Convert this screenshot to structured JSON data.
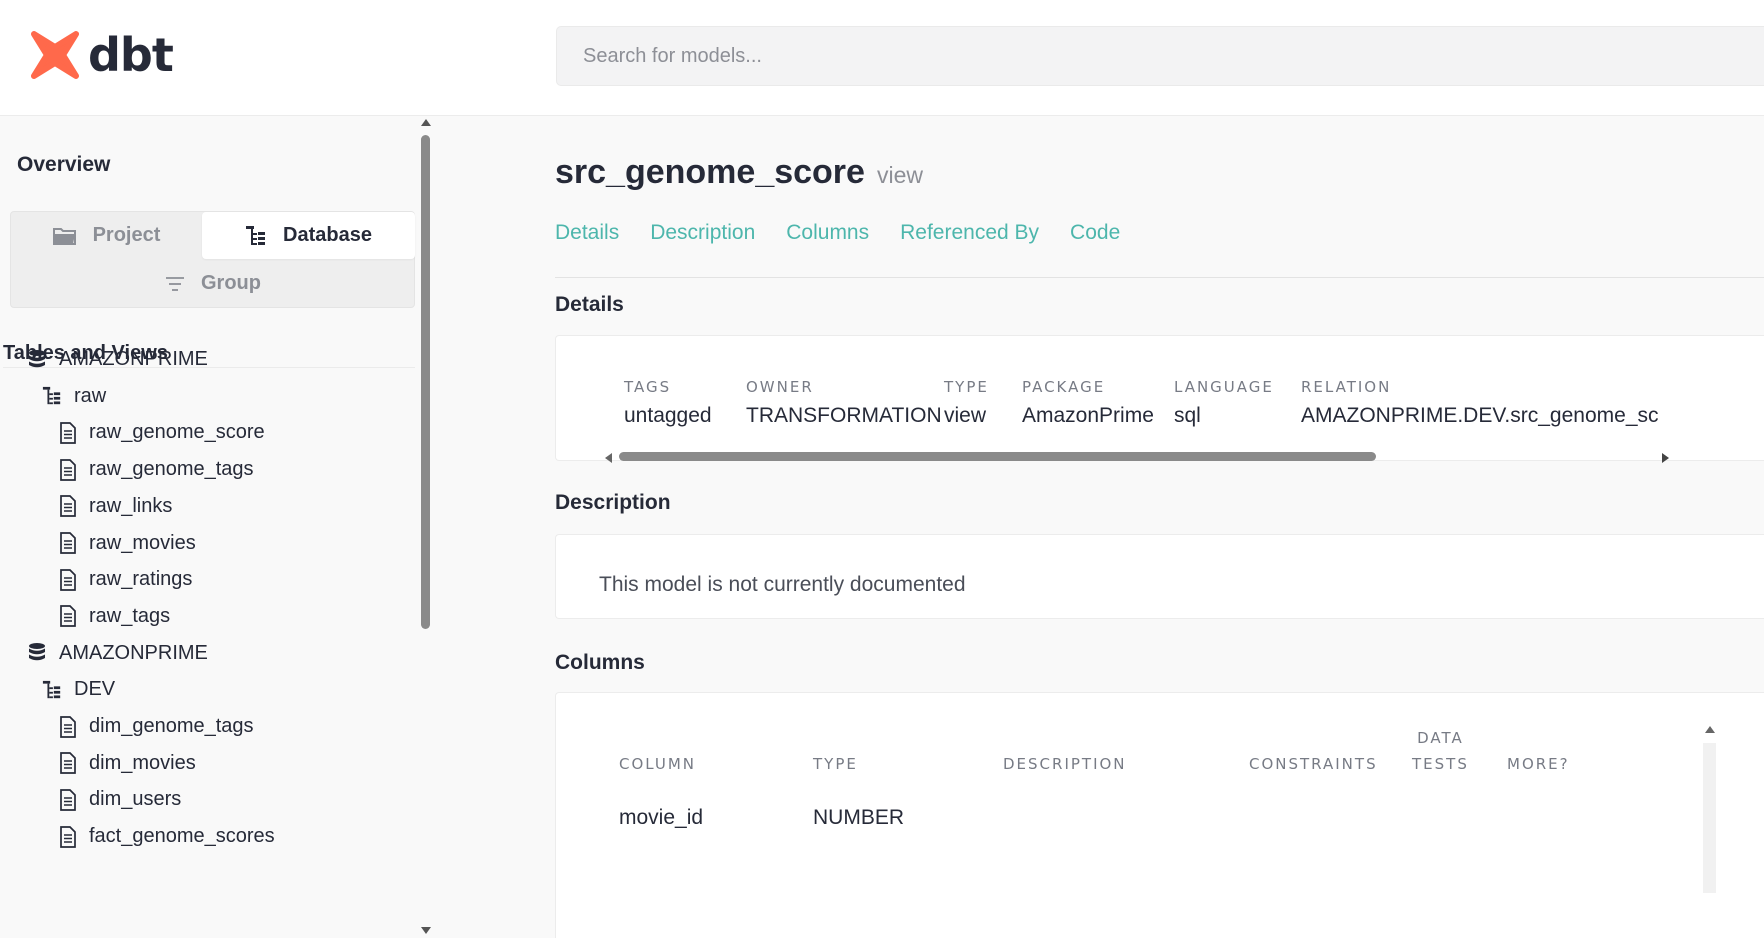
{
  "app": {
    "logo_text": "dbt",
    "brand_color": "#ff694b",
    "accent_color": "#4db6ac"
  },
  "search": {
    "placeholder": "Search for models..."
  },
  "sidebar": {
    "overview_label": "Overview",
    "switcher": {
      "project_label": "Project",
      "database_label": "Database",
      "group_label": "Group",
      "active": "Database"
    },
    "section_heading": "Tables and Views",
    "tree": [
      {
        "level": 0,
        "icon": "database-icon",
        "label": "AMAZONPRIME"
      },
      {
        "level": 1,
        "icon": "schema-tree-icon",
        "label": "raw"
      },
      {
        "level": 2,
        "icon": "document-icon",
        "label": "raw_genome_score"
      },
      {
        "level": 2,
        "icon": "document-icon",
        "label": "raw_genome_tags"
      },
      {
        "level": 2,
        "icon": "document-icon",
        "label": "raw_links"
      },
      {
        "level": 2,
        "icon": "document-icon",
        "label": "raw_movies"
      },
      {
        "level": 2,
        "icon": "document-icon",
        "label": "raw_ratings"
      },
      {
        "level": 2,
        "icon": "document-icon",
        "label": "raw_tags"
      },
      {
        "level": 0,
        "icon": "database-icon",
        "label": "AMAZONPRIME"
      },
      {
        "level": 1,
        "icon": "schema-tree-icon",
        "label": "DEV"
      },
      {
        "level": 2,
        "icon": "document-icon",
        "label": "dim_genome_tags"
      },
      {
        "level": 2,
        "icon": "document-icon",
        "label": "dim_movies"
      },
      {
        "level": 2,
        "icon": "document-icon",
        "label": "dim_users"
      },
      {
        "level": 2,
        "icon": "document-icon",
        "label": "fact_genome_scores"
      }
    ]
  },
  "model": {
    "name": "src_genome_score",
    "type_label": "view"
  },
  "tabs": [
    "Details",
    "Description",
    "Columns",
    "Referenced By",
    "Code"
  ],
  "details": {
    "heading": "Details",
    "fields": [
      {
        "label": "TAGS",
        "value": "untagged"
      },
      {
        "label": "OWNER",
        "value": "TRANSFORMATION"
      },
      {
        "label": "TYPE",
        "value": "view"
      },
      {
        "label": "PACKAGE",
        "value": "AmazonPrime"
      },
      {
        "label": "LANGUAGE",
        "value": "sql"
      },
      {
        "label": "RELATION",
        "value": "AMAZONPRIME.DEV.src_genome_sc"
      }
    ]
  },
  "description": {
    "heading": "Description",
    "text": "This model is not currently documented"
  },
  "columns": {
    "heading": "Columns",
    "headers": {
      "column": "COLUMN",
      "type": "TYPE",
      "description": "DESCRIPTION",
      "constraints": "CONSTRAINTS",
      "data_tests_1": "DATA",
      "data_tests_2": "TESTS",
      "more": "MORE?"
    },
    "rows": [
      {
        "column": "movie_id",
        "type": "NUMBER",
        "description": ""
      }
    ]
  }
}
